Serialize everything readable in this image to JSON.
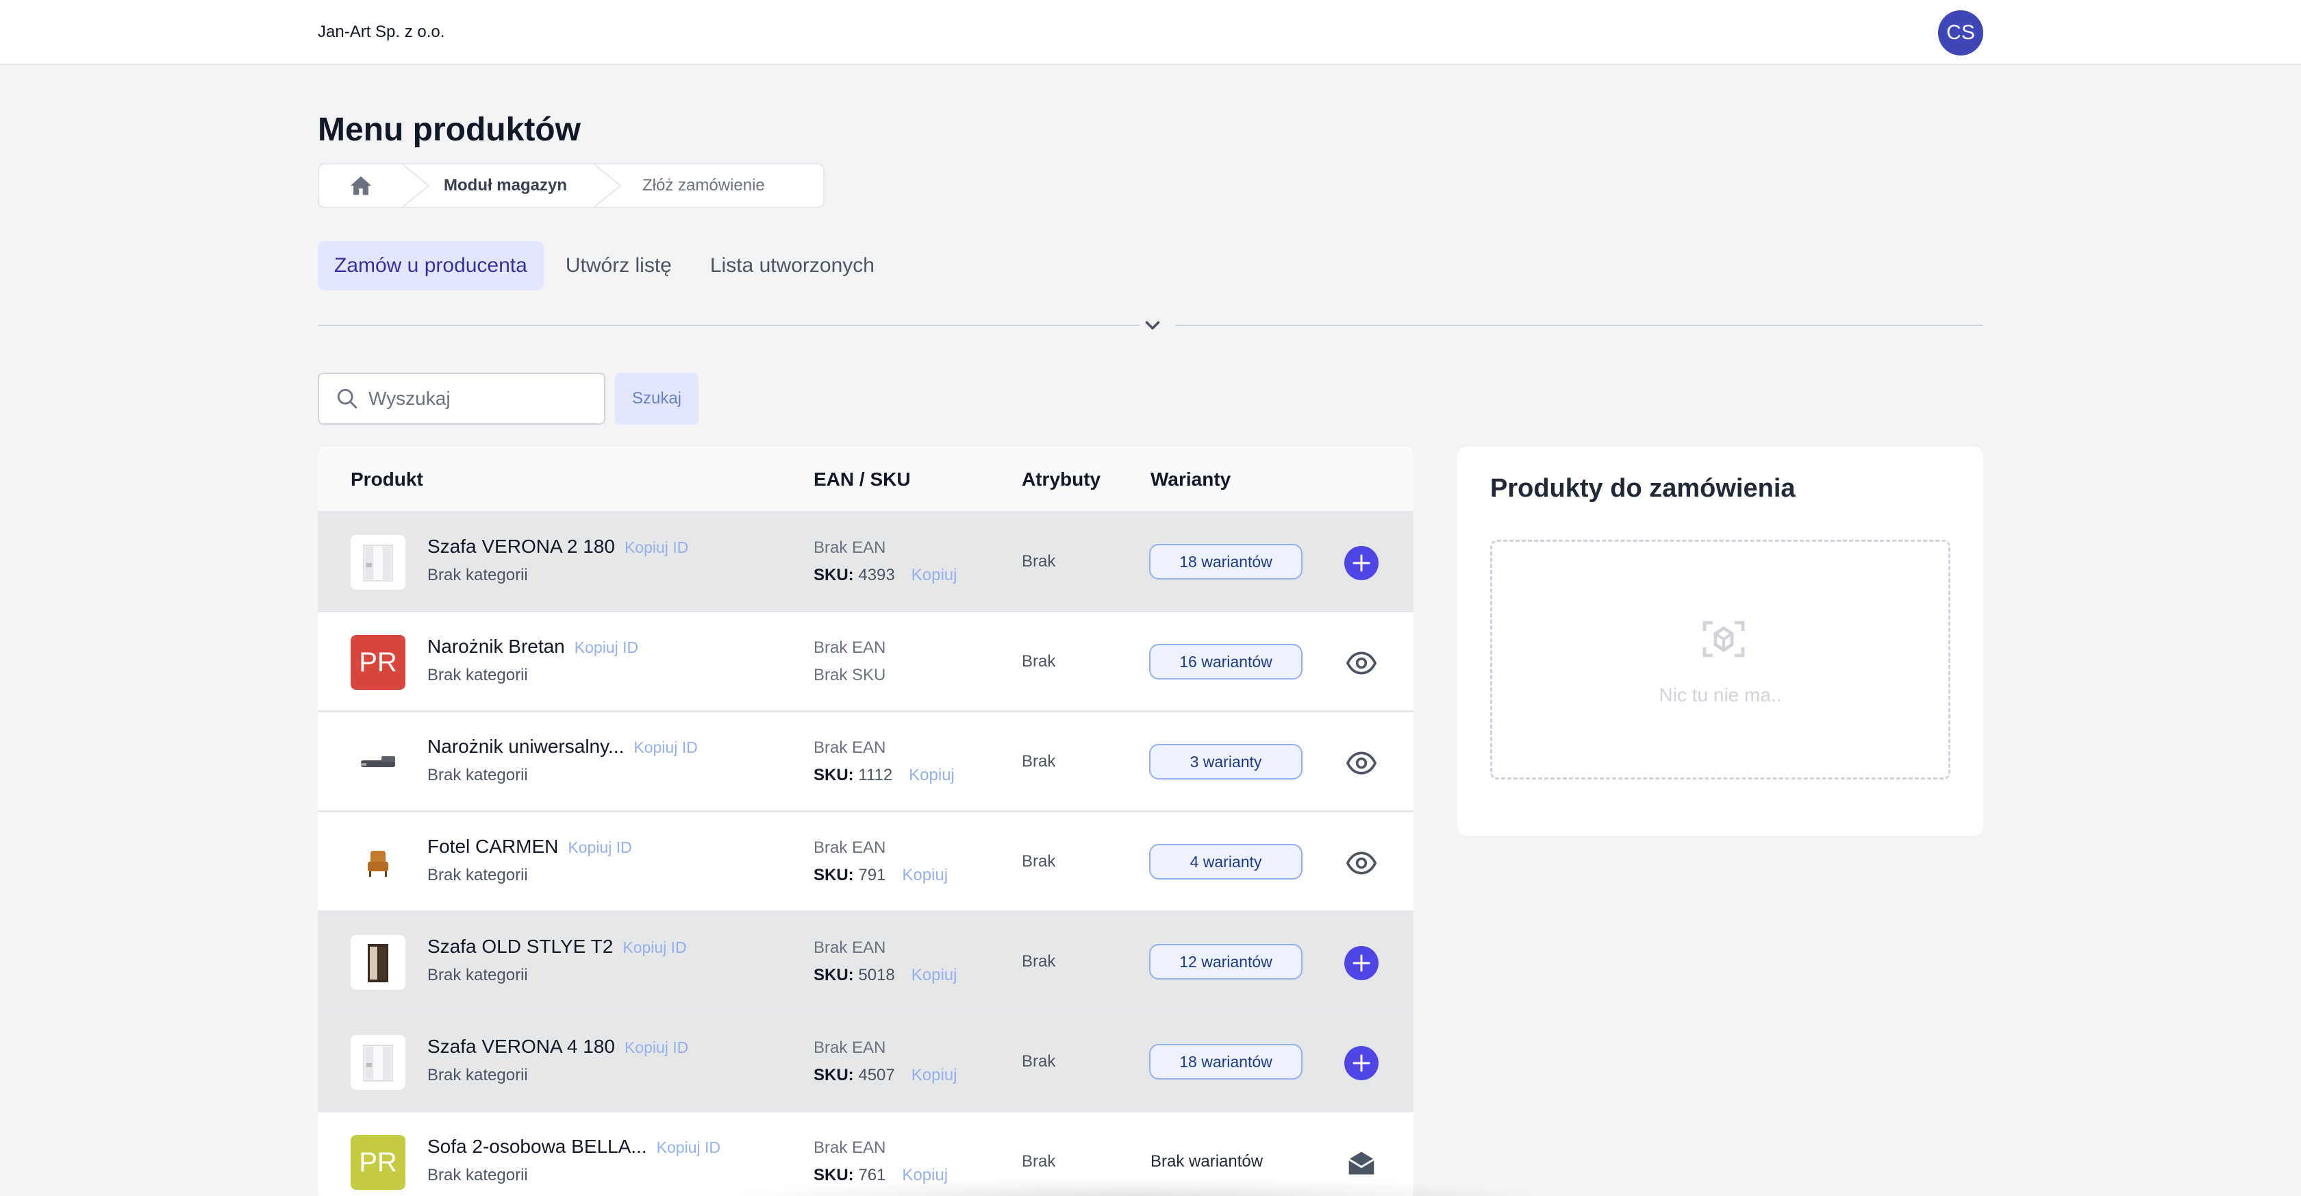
{
  "header": {
    "company": "Jan-Art Sp. z o.o.",
    "avatar_initials": "CS"
  },
  "page": {
    "title": "Menu produktów"
  },
  "breadcrumb": {
    "icon": "home-icon",
    "items": [
      "Moduł magazyn",
      "Złóż zamówienie"
    ]
  },
  "tabs": [
    {
      "label": "Zamów u producenta",
      "active": true
    },
    {
      "label": "Utwórz listę",
      "active": false
    },
    {
      "label": "Lista utworzonych",
      "active": false
    }
  ],
  "search": {
    "placeholder": "Wyszukaj",
    "button": "Szukaj"
  },
  "table": {
    "headers": {
      "product": "Produkt",
      "ean_sku": "EAN / SKU",
      "attributes": "Atrybuty",
      "variants": "Warianty"
    },
    "rows": [
      {
        "name": "Szafa VERONA 2 180",
        "copy": "Kopiuj ID",
        "category": "Brak kategorii",
        "ean": "Brak EAN",
        "sku_label": "SKU:",
        "sku": "4393",
        "sku_copy": "Kopiuj",
        "attr": "Brak",
        "variants": "18 wariantów",
        "action": "plus-icon",
        "thumb": "wardrobe-white"
      },
      {
        "name": "Narożnik Bretan",
        "copy": "Kopiuj ID",
        "category": "Brak kategorii",
        "ean": "Brak EAN",
        "sku_text": "Brak SKU",
        "attr": "Brak",
        "variants": "16 wariantów",
        "action": "eye-icon",
        "thumb_text": "PR",
        "thumb_color": "#d9473c"
      },
      {
        "name": "Narożnik uniwersalny...",
        "copy": "Kopiuj ID",
        "category": "Brak kategorii",
        "ean": "Brak EAN",
        "sku_label": "SKU:",
        "sku": "1112",
        "sku_copy": "Kopiuj",
        "attr": "Brak",
        "variants": "3 warianty",
        "action": "eye-icon",
        "thumb": "sofa-gray"
      },
      {
        "name": "Fotel CARMEN",
        "copy": "Kopiuj ID",
        "category": "Brak kategorii",
        "ean": "Brak EAN",
        "sku_label": "SKU:",
        "sku": "791",
        "sku_copy": "Kopiuj",
        "attr": "Brak",
        "variants": "4 warianty",
        "action": "eye-icon",
        "thumb": "armchair"
      },
      {
        "name": "Szafa OLD STLYE T2",
        "copy": "Kopiuj ID",
        "category": "Brak kategorii",
        "ean": "Brak EAN",
        "sku_label": "SKU:",
        "sku": "5018",
        "sku_copy": "Kopiuj",
        "attr": "Brak",
        "variants": "12 wariantów",
        "action": "plus-icon",
        "thumb": "wardrobe-dark"
      },
      {
        "name": "Szafa VERONA 4 180",
        "copy": "Kopiuj ID",
        "category": "Brak kategorii",
        "ean": "Brak EAN",
        "sku_label": "SKU:",
        "sku": "4507",
        "sku_copy": "Kopiuj",
        "attr": "Brak",
        "variants": "18 wariantów",
        "action": "plus-icon",
        "thumb": "wardrobe-white"
      },
      {
        "name": "Sofa 2-osobowa BELLA...",
        "copy": "Kopiuj ID",
        "category": "Brak kategorii",
        "ean": "Brak EAN",
        "sku_label": "SKU:",
        "sku": "761",
        "sku_copy": "Kopiuj",
        "attr": "Brak",
        "variants_text": "Brak wariantów",
        "action": "mail-open-icon",
        "thumb_text": "PR",
        "thumb_color": "#c5cc3f"
      }
    ]
  },
  "order_panel": {
    "title": "Produkty do zamówienia",
    "empty_text": "Nic tu nie ma..",
    "icon": "empty-box-icon"
  },
  "colors": {
    "accent": "#4f46e5",
    "tab_active_bg": "#e0e7ff",
    "avatar": "#3f46b8"
  }
}
